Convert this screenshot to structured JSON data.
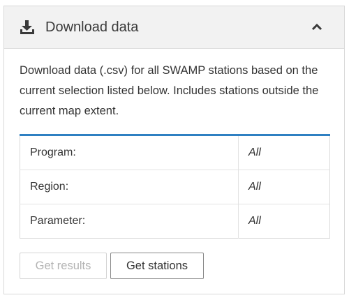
{
  "panel": {
    "title": "Download data",
    "icons": {
      "header": "download-icon",
      "toggle": "chevron-up-icon"
    },
    "description": "Download data (.csv) for all SWAMP stations based on the current selection listed below. Includes stations outside the current map extent.",
    "accent_color": "#2f80c2",
    "filters": [
      {
        "label": "Program:",
        "value": "All"
      },
      {
        "label": "Region:",
        "value": "All"
      },
      {
        "label": "Parameter:",
        "value": "All"
      }
    ],
    "buttons": {
      "get_results": "Get results",
      "get_stations": "Get stations"
    }
  }
}
